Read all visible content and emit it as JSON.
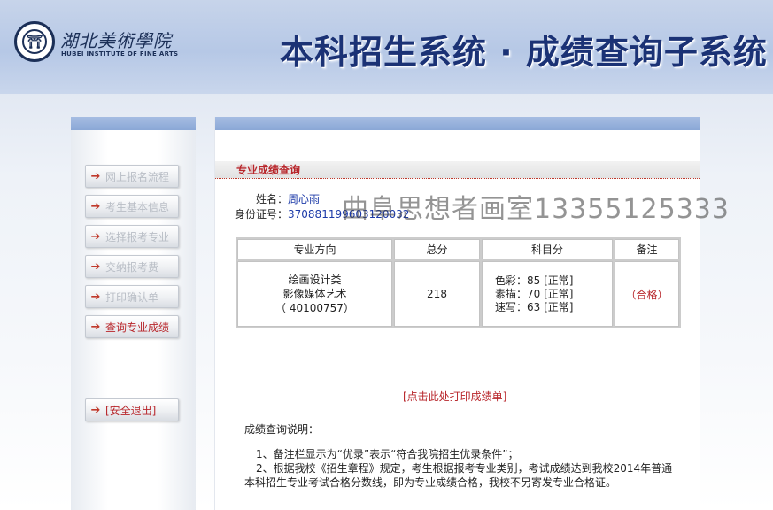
{
  "header": {
    "school_name_cn": "湖北美術學院",
    "school_name_en": "HUBEI INSTITUTE OF FINE ARTS",
    "system_title": "本科招生系统 · 成绩查询子系统",
    "brand_color": "#1b3275"
  },
  "sidebar": {
    "items": [
      {
        "label": "网上报名流程"
      },
      {
        "label": "考生基本信息"
      },
      {
        "label": "选择报考专业"
      },
      {
        "label": "交纳报考费"
      },
      {
        "label": "打印确认单"
      },
      {
        "label": "查询专业成绩"
      }
    ],
    "exit_label": "[安全退出]",
    "arrow_icon": "arrow-right-icon",
    "accent_color": "#b8262b"
  },
  "main": {
    "section_title": "专业成绩查询",
    "name_label": "姓名：",
    "name_value": "周心雨",
    "id_label": "身份证号：",
    "id_value": "370881199603120032",
    "watermark": "曲阜思想者画室13355125333",
    "table": {
      "headers": [
        "专业方向",
        "总分",
        "科目分",
        "备注"
      ],
      "row": {
        "major_lines": [
          "绘画设计类",
          "影像媒体艺术",
          "（ 40100757）"
        ],
        "total": "218",
        "subjects": [
          "色彩：85 [正常]",
          "素描：70 [正常]",
          "速写：63 [正常]"
        ],
        "remark": "（合格）"
      }
    },
    "print_link": "[点击此处打印成绩单]",
    "notes_title": "成绩查询说明：",
    "notes": [
      "1、备注栏显示为“优录”表示“符合我院招生优录条件”；",
      "2、根据我校《招生章程》规定，考生根据报考专业类别，考试成绩达到我校2014年普通",
      "本科招生专业考试合格分数线，即为专业成绩合格，我校不另寄发专业合格证。"
    ]
  }
}
